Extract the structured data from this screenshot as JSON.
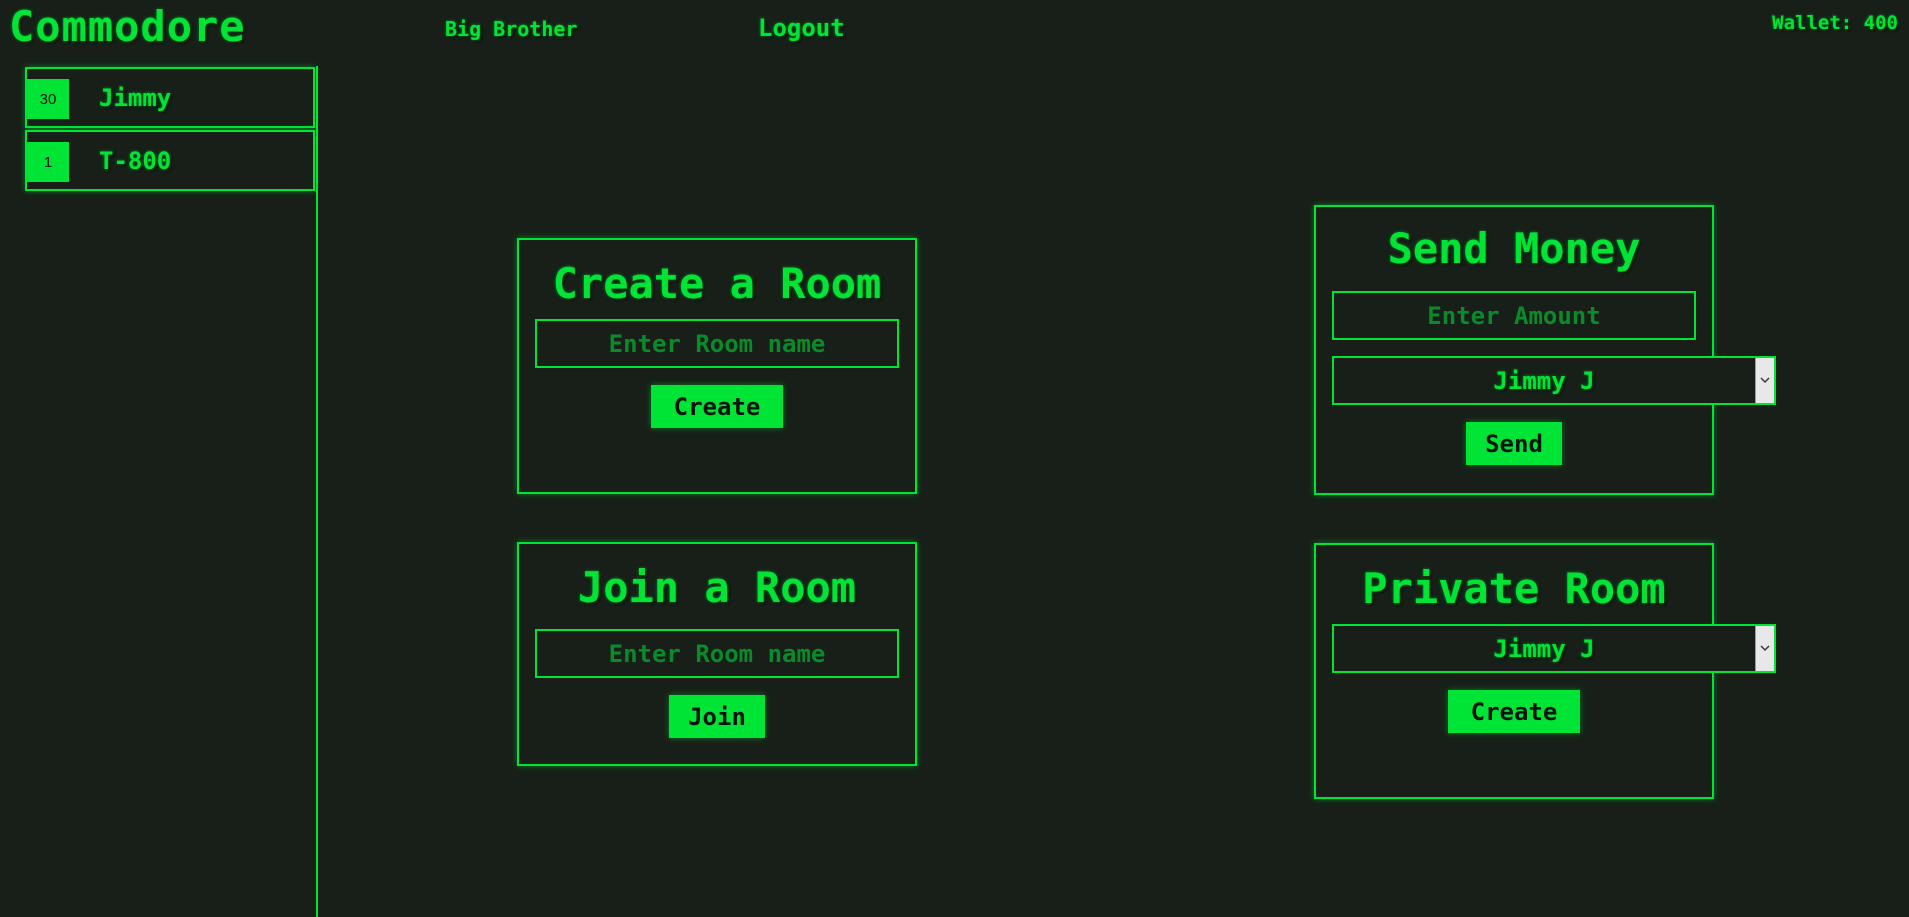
{
  "header": {
    "brand": "Commodore",
    "nav": {
      "big_brother": "Big Brother",
      "logout": "Logout"
    },
    "wallet": "Wallet: 400"
  },
  "sidebar": {
    "users": [
      {
        "badge": "30",
        "name": "Jimmy"
      },
      {
        "badge": "1",
        "name": "T-800"
      }
    ]
  },
  "create_room": {
    "title": "Create a Room",
    "placeholder": "Enter Room name",
    "button": "Create"
  },
  "join_room": {
    "title": "Join a Room",
    "placeholder": "Enter Room name",
    "button": "Join"
  },
  "send_money": {
    "title": "Send Money",
    "placeholder": "Enter Amount",
    "selected_user": "Jimmy J",
    "button": "Send"
  },
  "private_room": {
    "title": "Private Room",
    "selected_user": "Jimmy J",
    "button": "Create"
  },
  "theme": {
    "background": "#171f18",
    "accent": "#00e436"
  }
}
